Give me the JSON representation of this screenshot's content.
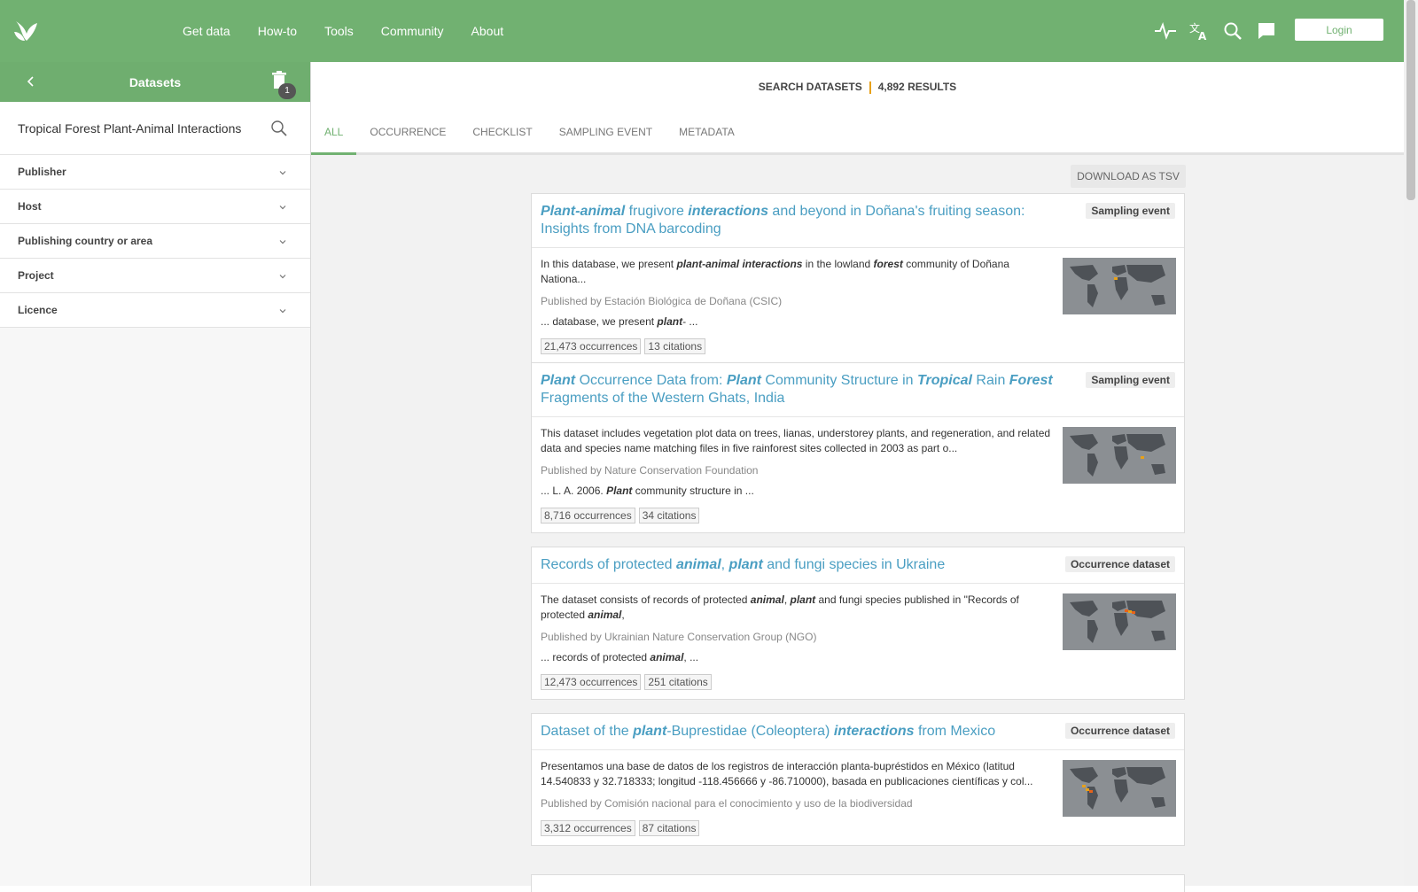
{
  "nav": {
    "items": [
      "Get data",
      "How-to",
      "Tools",
      "Community",
      "About"
    ],
    "login_label": "Login"
  },
  "icons": {
    "logo": "leaf-logo",
    "activity": "pulse-icon",
    "language": "translate-icon",
    "search": "search-icon",
    "feedback": "comment-icon",
    "back": "chevron-left-icon",
    "trash": "trash-icon",
    "chevron": "chevron-down-icon"
  },
  "sidebar": {
    "title": "Datasets",
    "trash_count": "1",
    "search_value": "Tropical Forest Plant-Animal Interactions",
    "filters": [
      "Publisher",
      "Host",
      "Publishing country or area",
      "Project",
      "Licence"
    ]
  },
  "main": {
    "results_label": "SEARCH DATASETS",
    "results_count": "4,892 RESULTS",
    "tabs": [
      "ALL",
      "OCCURRENCE",
      "CHECKLIST",
      "SAMPLING EVENT",
      "METADATA"
    ],
    "download_label": "DOWNLOAD AS TSV"
  },
  "cards": [
    {
      "title": [
        [
          "Plant-animal",
          true
        ],
        [
          " frugivore ",
          false
        ],
        [
          "interactions",
          true
        ],
        [
          " and beyond in Doñana's fruiting season: Insights from DNA barcoding",
          false
        ]
      ],
      "tag": "Sampling event",
      "desc": [
        [
          "In this database, we present ",
          false
        ],
        [
          "plant-animal interactions",
          true
        ],
        [
          " in the lowland ",
          false
        ],
        [
          "forest",
          true
        ],
        [
          " community of Doñana Nationa...",
          false
        ]
      ],
      "publisher": "Published by Estación Biológica de Doñana (CSIC)",
      "snippet": [
        [
          "... database, we present ",
          false
        ],
        [
          "plant",
          true
        ],
        [
          "- ...",
          false
        ]
      ],
      "occurrences": "21,473 occurrences",
      "citations": "13 citations"
    },
    {
      "title": [
        [
          "Plant",
          true
        ],
        [
          " Occurrence Data from: ",
          false
        ],
        [
          "Plant",
          true
        ],
        [
          " Community Structure in ",
          false
        ],
        [
          "Tropical",
          true
        ],
        [
          " Rain ",
          false
        ],
        [
          "Forest",
          true
        ],
        [
          " Fragments of the Western Ghats, India",
          false
        ]
      ],
      "tag": "Sampling event",
      "desc": [
        [
          "This dataset includes vegetation plot data on trees, lianas, understorey plants, and regeneration, and related data and species name matching files in five rainforest sites collected in 2003 as part o...",
          false
        ]
      ],
      "publisher": "Published by Nature Conservation Foundation",
      "snippet": [
        [
          "... L. A. 2006. ",
          false
        ],
        [
          "Plant",
          true
        ],
        [
          " community structure in ...",
          false
        ]
      ],
      "occurrences": "8,716 occurrences",
      "citations": "34 citations"
    },
    {
      "title": [
        [
          "Records of protected ",
          false
        ],
        [
          "animal",
          true
        ],
        [
          ", ",
          false
        ],
        [
          "plant",
          true
        ],
        [
          " and fungi species in Ukraine",
          false
        ]
      ],
      "tag": "Occurrence dataset",
      "desc": [
        [
          "The dataset consists of records of protected ",
          false
        ],
        [
          "animal",
          true
        ],
        [
          ", ",
          false
        ],
        [
          "plant",
          true
        ],
        [
          " and fungi species published in \"Records of protected ",
          false
        ],
        [
          "animal",
          true
        ],
        [
          ",",
          false
        ]
      ],
      "publisher": "Published by Ukrainian Nature Conservation Group (NGO)",
      "snippet": [
        [
          "... records of protected ",
          false
        ],
        [
          "animal",
          true
        ],
        [
          ", ...",
          false
        ]
      ],
      "occurrences": "12,473 occurrences",
      "citations": "251 citations"
    },
    {
      "title": [
        [
          "Dataset of the ",
          false
        ],
        [
          "plant",
          true
        ],
        [
          "-Buprestidae (Coleoptera) ",
          false
        ],
        [
          "interactions",
          true
        ],
        [
          " from Mexico",
          false
        ]
      ],
      "tag": "Occurrence dataset",
      "desc": [
        [
          "Presentamos una base de datos de los registros de interacción planta-bupréstidos en México (latitud 14.540833 y 32.718333; longitud -118.456666 y -86.710000), basada en publicaciones científicas y col...",
          false
        ]
      ],
      "publisher": "Published by Comisión nacional para el conocimiento y uso de la biodiversidad",
      "snippet": [],
      "occurrences": "3,312 occurrences",
      "citations": "87 citations"
    }
  ],
  "colors": {
    "brand_green": "#71b171",
    "link_blue": "#4a9ec2",
    "accent_orange": "#e7a11a"
  }
}
